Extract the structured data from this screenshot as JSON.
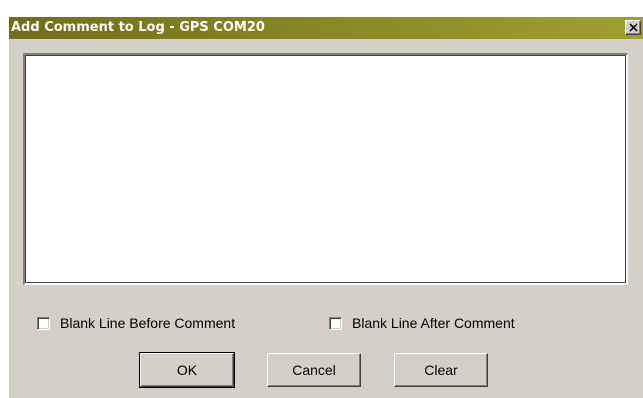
{
  "window": {
    "title": "Add Comment to Log - GPS COM20",
    "titlebar_color_start": "#6f6f1a",
    "titlebar_color_end": "#a0a030"
  },
  "comment": {
    "value": ""
  },
  "options": {
    "blank_before_label": "Blank Line Before Comment",
    "blank_before_checked": false,
    "blank_after_label": "Blank Line After Comment",
    "blank_after_checked": false
  },
  "buttons": {
    "ok_label": "OK",
    "cancel_label": "Cancel",
    "clear_label": "Clear"
  },
  "icons": {
    "close": "close-icon"
  }
}
